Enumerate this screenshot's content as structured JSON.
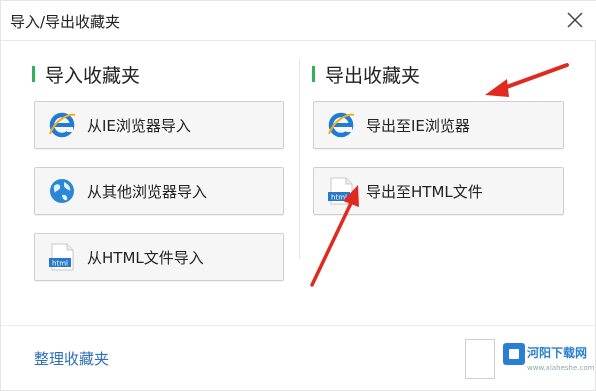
{
  "window": {
    "title": "导入/导出收藏夹"
  },
  "import_section": {
    "heading": "导入收藏夹",
    "buttons": [
      {
        "label": "从IE浏览器导入",
        "icon": "ie-icon"
      },
      {
        "label": "从其他浏览器导入",
        "icon": "globe-icon"
      },
      {
        "label": "从HTML文件导入",
        "icon": "html-file-icon"
      }
    ]
  },
  "export_section": {
    "heading": "导出收藏夹",
    "buttons": [
      {
        "label": "导出至IE浏览器",
        "icon": "ie-icon"
      },
      {
        "label": "导出至HTML文件",
        "icon": "html-file-icon"
      }
    ]
  },
  "footer": {
    "manage_link": "整理收藏夹"
  },
  "html_icon_text": "html",
  "watermark": {
    "brand": "河阳下载网",
    "url": "www.xiaheshe.com"
  },
  "colors": {
    "accent_bar": "#2fb35a",
    "link": "#2d6fb8",
    "arrow": "#e02a1f",
    "ie_blue": "#1e7bd8"
  }
}
